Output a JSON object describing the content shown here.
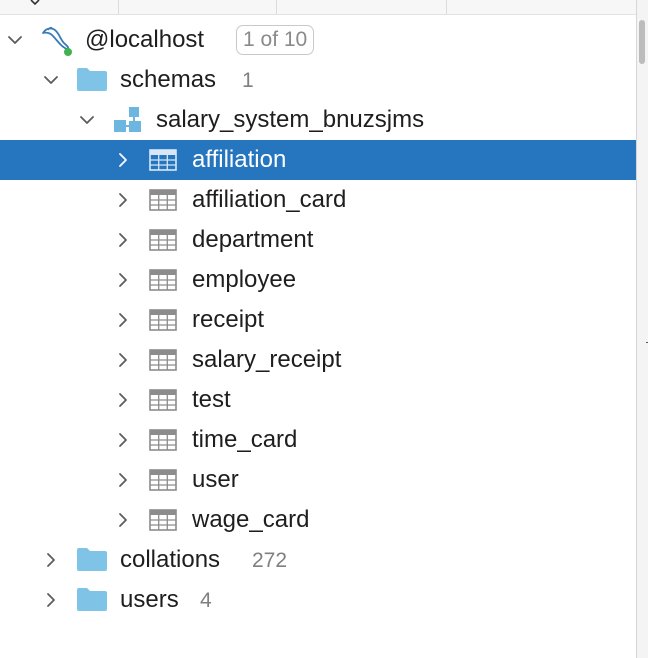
{
  "connection": {
    "name": "@localhost",
    "badge": "1 of 10",
    "icon": "mysql-dolphin-icon",
    "status_color": "#3fb34f"
  },
  "schemas_node": {
    "label": "schemas",
    "count": "1"
  },
  "schema": {
    "name": "salary_system_bnuzsjms",
    "icon": "schema-icon"
  },
  "tables": [
    {
      "name": "affiliation",
      "selected": true
    },
    {
      "name": "affiliation_card",
      "selected": false
    },
    {
      "name": "department",
      "selected": false
    },
    {
      "name": "employee",
      "selected": false
    },
    {
      "name": "receipt",
      "selected": false
    },
    {
      "name": "salary_receipt",
      "selected": false
    },
    {
      "name": "test",
      "selected": false
    },
    {
      "name": "time_card",
      "selected": false
    },
    {
      "name": "user",
      "selected": false
    },
    {
      "name": "wage_card",
      "selected": false
    }
  ],
  "collations_node": {
    "label": "collations",
    "count": "272"
  },
  "users_node": {
    "label": "users",
    "count": "4"
  },
  "colors": {
    "selection": "#2675bf",
    "folder": "#7fc3e6",
    "table_icon": "#8c8c8c"
  }
}
